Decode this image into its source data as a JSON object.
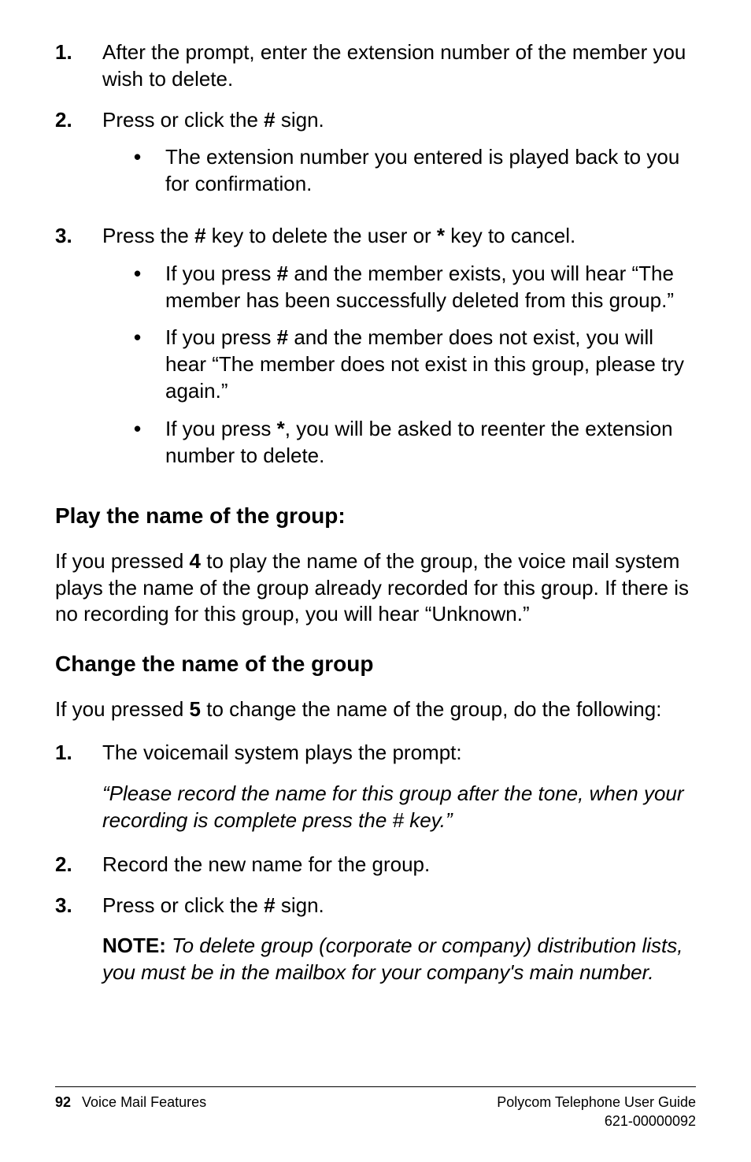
{
  "list1": {
    "item1": {
      "num": "1.",
      "text": "After the prompt, enter the extension number of the member you wish to delete."
    },
    "item2": {
      "num": "2.",
      "text_a": "Press or click the ",
      "hash": "#",
      "text_b": " sign.",
      "sub1": "The extension number you entered is played back to you for confirmation."
    },
    "item3": {
      "num": "3.",
      "text_a": "Press the ",
      "hash1": "#",
      "text_b": " key to delete the user or ",
      "star1": "*",
      "text_c": " key to cancel.",
      "sub1_a": "If you press ",
      "sub1_hash": "#",
      "sub1_b": " and the member exists, you will hear “The member has been successfully deleted from this group.”",
      "sub2_a": "If you press ",
      "sub2_hash": "#",
      "sub2_b": " and the member does not exist, you will hear “The member does not exist in this group, please try again.”",
      "sub3_a": " If you press ",
      "sub3_star": "*",
      "sub3_b": ", you will be asked to reenter the extension number to delete."
    }
  },
  "section1": {
    "heading": "Play the name of the group:",
    "para_a": "If you pressed ",
    "para_bold": "4",
    "para_b": " to play the name of the group, the voice mail system plays the name of the group already recorded for this group. If there is no recording for this group, you will hear “Unknown.”"
  },
  "section2": {
    "heading": "Change the name of the group",
    "intro_a": "If you pressed ",
    "intro_bold": "5",
    "intro_b": " to change the name of the group, do the following:",
    "item1": {
      "num": "1.",
      "text": "The voicemail system plays the prompt:",
      "quote": "“Please record the name for this group after the tone, when your recording is complete press the # key.”"
    },
    "item2": {
      "num": "2.",
      "text": "Record the new name for the group."
    },
    "item3": {
      "num": "3.",
      "text_a": "Press or click the ",
      "hash": "#",
      "text_b": " sign.",
      "note_bold": "NOTE:",
      "note_rest": " To delete group (corporate or company) distribution lists, you must be in the mailbox for your company's main number."
    }
  },
  "footer": {
    "page": "92",
    "section": "Voice Mail Features",
    "right1": "Polycom Telephone User Guide",
    "right2": "621-00000092"
  }
}
